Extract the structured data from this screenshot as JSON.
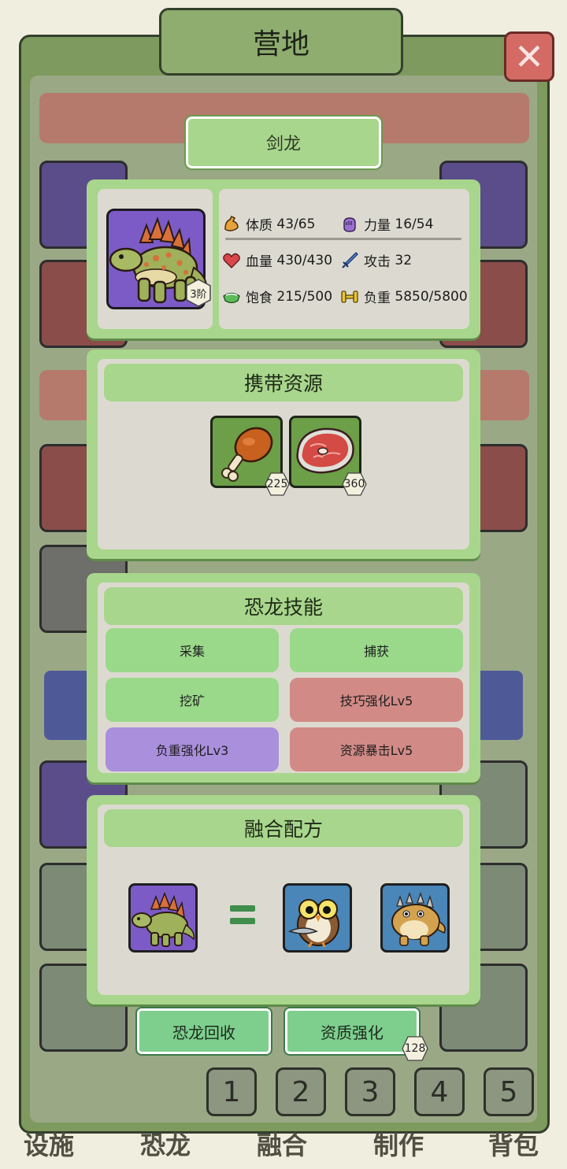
{
  "screen": {
    "title": "营地",
    "close_icon": "close-x-icon"
  },
  "background_tabs": [
    "设施",
    "恐龙",
    "融合",
    "制作",
    "背包"
  ],
  "page_numbers": [
    "1",
    "2",
    "3",
    "4",
    "5"
  ],
  "dinosaur": {
    "name": "剑龙",
    "tier": "3阶",
    "portrait_icon": "stegosaurus-icon",
    "stats": {
      "constitution": {
        "label": "体质",
        "value": "43/65",
        "icon": "muscle-icon"
      },
      "strength": {
        "label": "力量",
        "value": "16/54",
        "icon": "fist-icon"
      },
      "health": {
        "label": "血量",
        "value": "430/430",
        "icon": "heart-icon"
      },
      "attack": {
        "label": "攻击",
        "value": "32",
        "icon": "sword-icon"
      },
      "satiety": {
        "label": "饱食",
        "value": "215/500",
        "icon": "food-bowl-icon"
      },
      "load": {
        "label": "负重",
        "value": "5850/5800",
        "icon": "dumbbell-icon"
      }
    }
  },
  "resources": {
    "title": "携带资源",
    "items": [
      {
        "icon": "drumstick-icon",
        "count": "225"
      },
      {
        "icon": "steak-icon",
        "count": "360"
      }
    ]
  },
  "skills": {
    "title": "恐龙技能",
    "items": [
      {
        "label": "采集",
        "color": "#9ad88a"
      },
      {
        "label": "捕获",
        "color": "#9ad88a"
      },
      {
        "label": "挖矿",
        "color": "#9ad88a"
      },
      {
        "label": "技巧强化Lv5",
        "color": "#d28a86"
      },
      {
        "label": "负重强化Lv3",
        "color": "#a98fdc"
      },
      {
        "label": "资源暴击Lv5",
        "color": "#d28a86"
      }
    ]
  },
  "fusion": {
    "title": "融合配方",
    "result_icon": "stegosaurus-icon",
    "ingredients": [
      "owl-icon",
      "ankylosaurus-icon"
    ]
  },
  "actions": {
    "recycle_label": "恐龙回收",
    "enhance_label": "资质强化",
    "enhance_cost": "128"
  },
  "colors": {
    "card_green": "#a8d68c",
    "card_inner": "#dcdad0",
    "portrait_purple": "#7d5bc6",
    "resource_slot": "#6c9f47",
    "fusion_blue": "#4a86b8"
  }
}
